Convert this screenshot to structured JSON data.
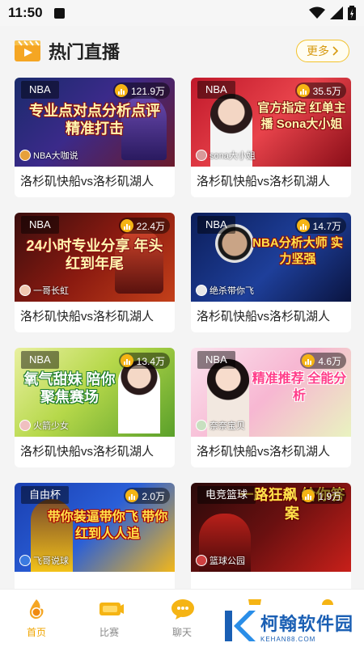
{
  "status_bar": {
    "time": "11:50"
  },
  "header": {
    "title": "热门直播",
    "more_label": "更多"
  },
  "cards": [
    {
      "tag": "NBA",
      "views": "121.9万",
      "headline": "专业点对点分析点评 精准打击",
      "host": "NBA大咖说",
      "title": "洛杉矶快船vs洛杉矶湖人"
    },
    {
      "tag": "NBA",
      "views": "35.5万",
      "headline": "官方指定 红单主播 Sona大小姐",
      "host": "sona大小姐",
      "title": "洛杉矶快船vs洛杉矶湖人"
    },
    {
      "tag": "NBA",
      "views": "22.4万",
      "headline": "24小时专业分享 年头红到年尾",
      "host": "一哥长虹",
      "title": "洛杉矶快船vs洛杉矶湖人"
    },
    {
      "tag": "NBA",
      "views": "14.7万",
      "headline": "NBA分析大师 实力坚强",
      "host": "绝杀带你飞",
      "title": "洛杉矶快船vs洛杉矶湖人"
    },
    {
      "tag": "NBA",
      "views": "13.4万",
      "headline": "氧气甜妹 陪你聚焦赛场",
      "host": "火箭少女",
      "title": "洛杉矶快船vs洛杉矶湖人"
    },
    {
      "tag": "NBA",
      "views": "4.6万",
      "headline": "精准推荐 全能分析",
      "host": "奈奈宝贝",
      "title": "洛杉矶快船vs洛杉矶湖人"
    },
    {
      "tag": "自由杯",
      "views": "2.0万",
      "headline": "带你装逼带你飞 带你红到人人追",
      "host": "飞哥说球",
      "title": ""
    },
    {
      "tag": "电竞篮球",
      "views": "1.9万",
      "headline": "一路狂飙 给你答案",
      "host": "篮球公园",
      "title": ""
    }
  ],
  "tabbar": {
    "items": [
      {
        "label": "首页",
        "color": "#f0a500"
      },
      {
        "label": "比赛",
        "color": "#f5b414"
      },
      {
        "label": "聊天",
        "color": "#f5b414"
      }
    ]
  },
  "watermark": {
    "brand": "柯翰软件园",
    "domain": "KEHAN88.COM"
  },
  "colors": {
    "accent": "#f5b414",
    "link": "#1a5fb4"
  }
}
